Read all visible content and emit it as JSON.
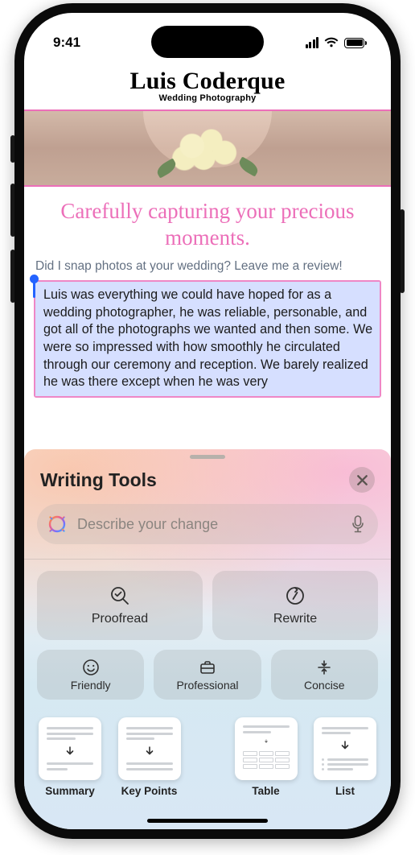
{
  "status": {
    "time": "9:41"
  },
  "header": {
    "brand": "Luis Coderque",
    "subtitle": "Wedding Photography"
  },
  "tagline": "Carefully capturing your precious moments.",
  "prompt": "Did I snap photos at your wedding? Leave me a review!",
  "selected_text": "Luis was everything we could have hoped for as a wedding photographer, he was reliable, personable, and got all of the photographs we wanted and then some. We were so impressed with how smoothly he circulated through our ceremony and reception. We barely realized he was there except when he was very",
  "sheet": {
    "title": "Writing Tools",
    "input_placeholder": "Describe your change",
    "proofread": "Proofread",
    "rewrite": "Rewrite",
    "friendly": "Friendly",
    "professional": "Professional",
    "concise": "Concise",
    "summary": "Summary",
    "keypoints": "Key Points",
    "table": "Table",
    "list": "List"
  }
}
